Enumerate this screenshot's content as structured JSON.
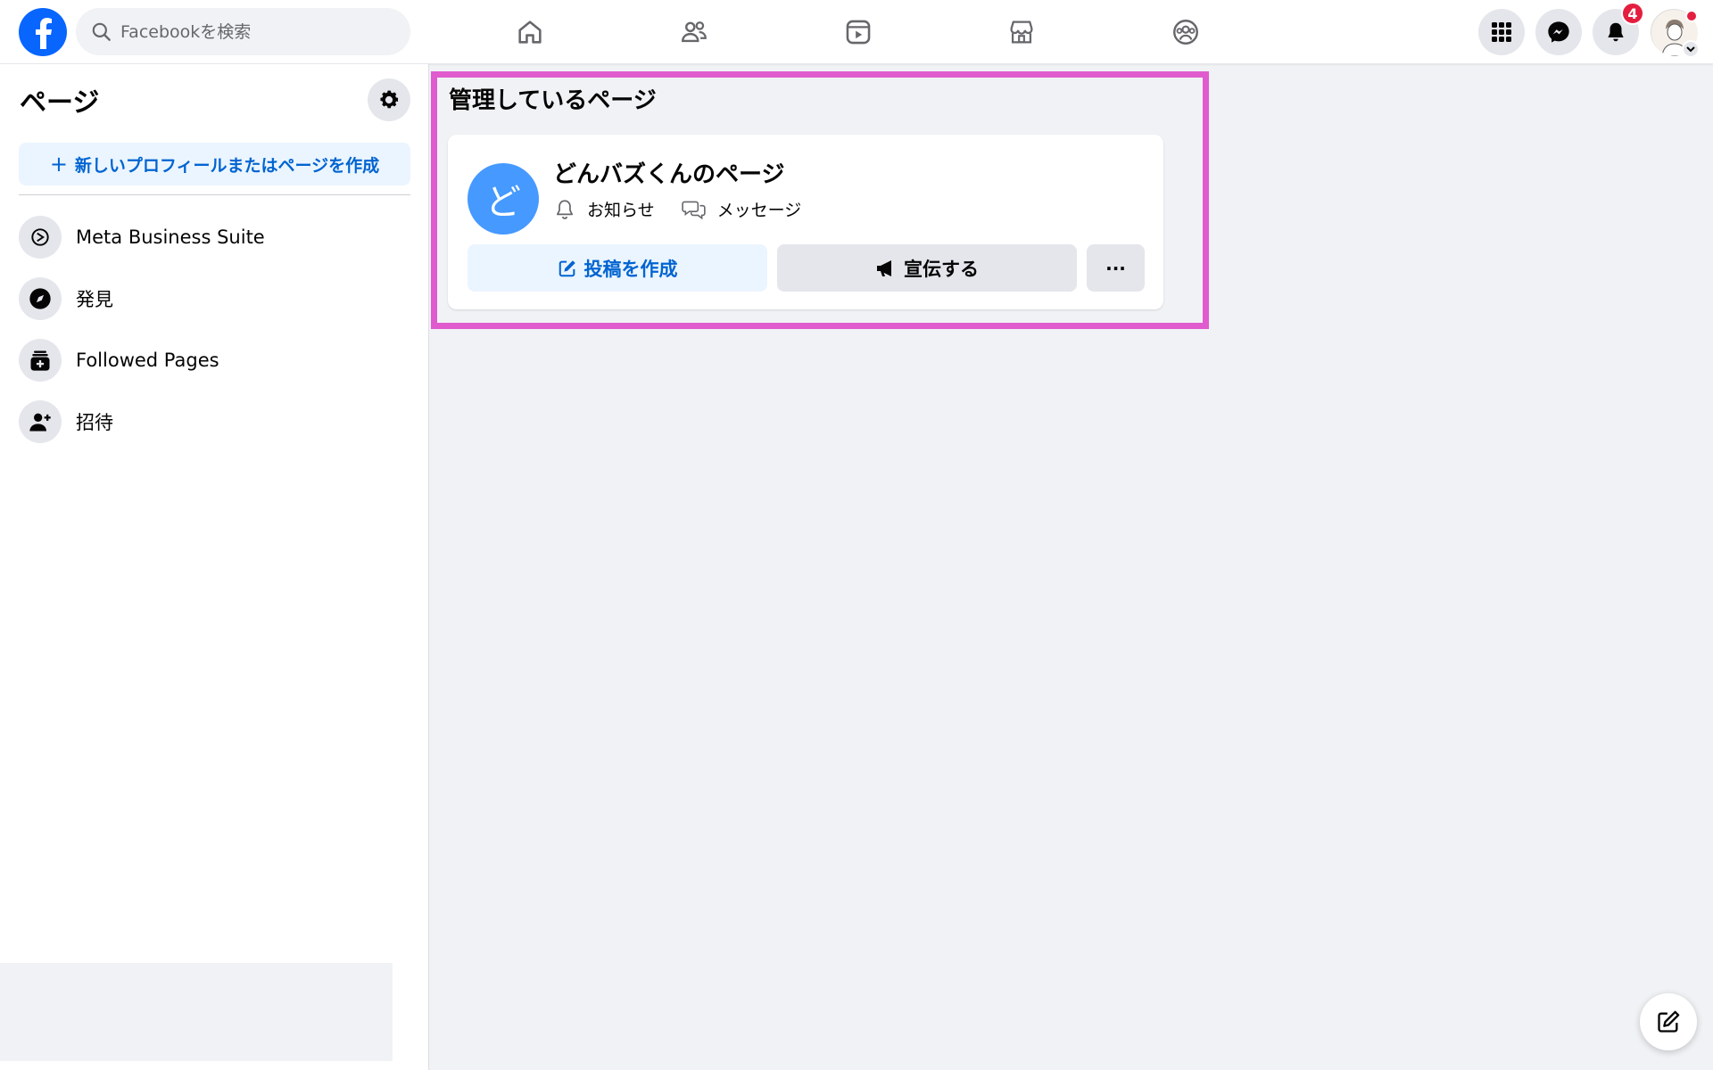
{
  "topbar": {
    "search_placeholder": "Facebookを検索",
    "notification_count": "4"
  },
  "sidebar": {
    "title": "ページ",
    "create_label": "新しいプロフィールまたはページを作成",
    "items": [
      {
        "label": "Meta Business Suite",
        "icon": "meta-business-suite-icon"
      },
      {
        "label": "発見",
        "icon": "compass-icon"
      },
      {
        "label": "Followed Pages",
        "icon": "followed-pages-icon"
      },
      {
        "label": "招待",
        "icon": "invite-icon"
      }
    ]
  },
  "main": {
    "title": "管理しているページ",
    "page": {
      "avatar_letter": "ど",
      "name": "どんバズくんのページ",
      "notifications_label": "お知らせ",
      "messages_label": "メッセージ",
      "post_label": "投稿を作成",
      "promote_label": "宣伝する",
      "more_label": "···"
    }
  },
  "colors": {
    "brand_blue": "#0866ff",
    "link_blue": "#0064d1",
    "highlight": "#e05bce",
    "badge_red": "#e41e3f"
  }
}
